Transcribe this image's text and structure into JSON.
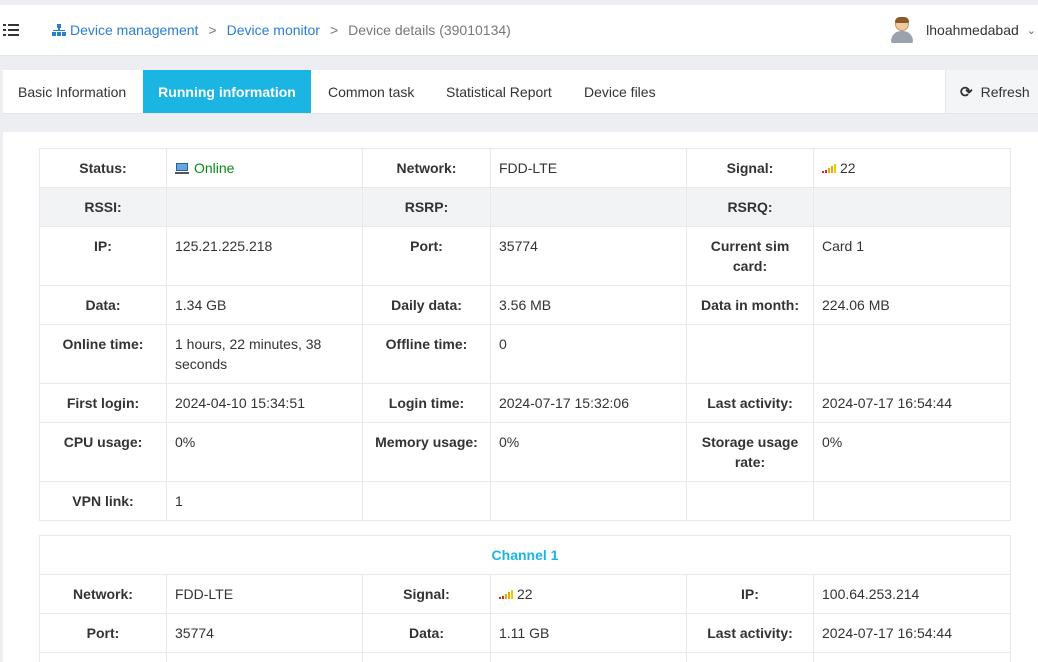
{
  "header": {
    "breadcrumb": {
      "device_management": "Device management",
      "device_monitor": "Device monitor",
      "current": "Device details (39010134)",
      "separator": ">"
    },
    "user": {
      "name": "lhoahmedabad"
    },
    "icons": {
      "menu": "menu-toggle-icon",
      "breadcrumb": "sitemap-icon",
      "user": "user-avatar-icon",
      "dropdown": "chevron-down-icon"
    }
  },
  "tabs": {
    "items": [
      "Basic Information",
      "Running information",
      "Common task",
      "Statistical Report",
      "Device files"
    ],
    "active": "Running information",
    "refresh_label": "Refresh",
    "accent_color": "#1ab5e3"
  },
  "info": {
    "rows": [
      [
        {
          "label": "Status:",
          "value": "Online"
        },
        {
          "label": "Network:",
          "value": "FDD-LTE"
        },
        {
          "label": "Signal:",
          "value": "22"
        }
      ],
      [
        {
          "label": "RSSI:",
          "value": ""
        },
        {
          "label": "RSRP:",
          "value": ""
        },
        {
          "label": "RSRQ:",
          "value": ""
        }
      ],
      [
        {
          "label": "IP:",
          "value": "125.21.225.218"
        },
        {
          "label": "Port:",
          "value": "35774"
        },
        {
          "label": "Current sim card:",
          "value": "Card 1"
        }
      ],
      [
        {
          "label": "Data:",
          "value": "1.34 GB"
        },
        {
          "label": "Daily data:",
          "value": "3.56 MB"
        },
        {
          "label": "Data in month:",
          "value": "224.06 MB"
        }
      ],
      [
        {
          "label": "Online time:",
          "value": "1 hours, 22 minutes, 38 seconds"
        },
        {
          "label": "Offline time:",
          "value": "0"
        },
        {
          "label": "",
          "value": ""
        }
      ],
      [
        {
          "label": "First login:",
          "value": "2024-04-10 15:34:51"
        },
        {
          "label": "Login time:",
          "value": "2024-07-17 15:32:06"
        },
        {
          "label": "Last activity:",
          "value": "2024-07-17 16:54:44"
        }
      ],
      [
        {
          "label": "CPU usage:",
          "value": "0%"
        },
        {
          "label": "Memory usage:",
          "value": "0%"
        },
        {
          "label": "Storage usage rate:",
          "value": "0%"
        }
      ],
      [
        {
          "label": "VPN link:",
          "value": "1"
        },
        {
          "label": "",
          "value": ""
        },
        {
          "label": "",
          "value": ""
        }
      ]
    ],
    "status_color": "#0a8a1a"
  },
  "channel": {
    "title": "Channel 1",
    "rows": [
      [
        {
          "label": "Network:",
          "value": "FDD-LTE"
        },
        {
          "label": "Signal:",
          "value": "22"
        },
        {
          "label": "IP:",
          "value": "100.64.253.214"
        }
      ],
      [
        {
          "label": "Port:",
          "value": "35774"
        },
        {
          "label": "Data:",
          "value": "1.11 GB"
        },
        {
          "label": "Last activity:",
          "value": "2024-07-17 16:54:44"
        }
      ]
    ]
  }
}
